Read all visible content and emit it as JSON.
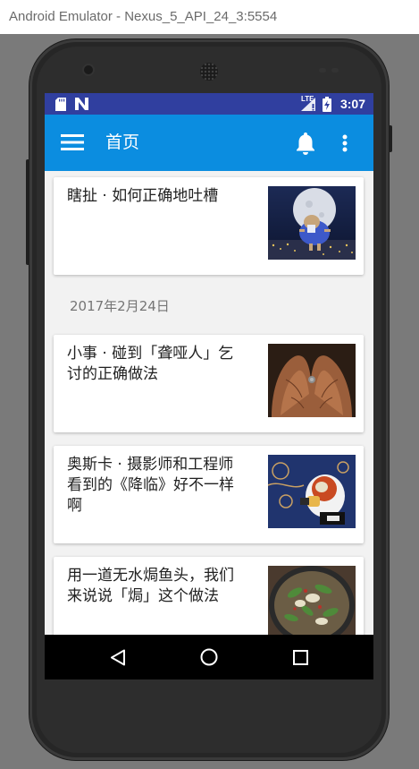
{
  "window": {
    "title": "Android Emulator - Nexus_5_API_24_3:5554"
  },
  "statusbar": {
    "time": "3:07"
  },
  "appbar": {
    "title": "首页"
  },
  "feed": {
    "cards_top": [
      {
        "title": "瞎扯 · 如何正确地吐槽"
      }
    ],
    "date_header": "2017年2月24日",
    "cards": [
      {
        "title": "小事 · 碰到「聋哑人」乞讨的正确做法"
      },
      {
        "title": "奥斯卡 · 摄影师和工程师看到的《降临》好不一样啊"
      },
      {
        "title": "用一道无水焗鱼头，我们来说说「焗」这个做法"
      }
    ]
  },
  "colors": {
    "statusbar": "#303f9f",
    "appbar": "#0b8de0",
    "background": "#f2f2f2"
  },
  "icons": {
    "menu": "menu-icon",
    "notifications": "bell-icon",
    "overflow": "more-vert-icon",
    "back": "back-triangle-icon",
    "home": "home-circle-icon",
    "recents": "recents-square-icon"
  }
}
